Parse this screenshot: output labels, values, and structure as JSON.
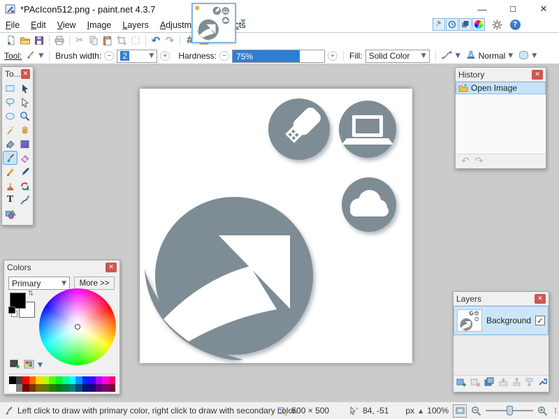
{
  "window": {
    "title": "*PAcIcon512.png - paint.net 4.3.7",
    "controls": {
      "minimize": "–",
      "maximize": "▢",
      "close": "✕"
    }
  },
  "menu": {
    "items": [
      {
        "label": "File",
        "underline_index": 0
      },
      {
        "label": "Edit",
        "underline_index": 0
      },
      {
        "label": "View",
        "underline_index": 0
      },
      {
        "label": "Image",
        "underline_index": 0
      },
      {
        "label": "Layers",
        "underline_index": 0
      },
      {
        "label": "Adjustments",
        "underline_index": 0
      },
      {
        "label": "Effects",
        "underline_index": 4
      }
    ]
  },
  "top_right_icons": [
    "tools-toggle-icon",
    "history-toggle-icon",
    "layers-toggle-icon",
    "colors-toggle-icon",
    "settings-gear-icon",
    "help-icon"
  ],
  "toolbar_icons": [
    "new-file-icon",
    "open-folder-icon",
    "save-icon",
    "print-icon",
    "cut-icon",
    "copy-icon",
    "paste-icon",
    "crop-icon",
    "deselect-icon",
    "undo-icon",
    "redo-icon",
    "grid-icon",
    "ruler-icon"
  ],
  "tool_options": {
    "tool_label": "Tool:",
    "brush_width_label": "Brush width:",
    "brush_width_value": "2",
    "hardness_label": "Hardness:",
    "hardness_value": "75%",
    "hardness_fill_percent": 73,
    "fill_label": "Fill:",
    "fill_value": "Solid Color",
    "blend_mode_value": "Normal"
  },
  "image_tab": {
    "icons": [
      "unsaved-star-icon",
      "thumbnail-pdn-logo"
    ],
    "chevron": "⌄"
  },
  "panels": {
    "tools": {
      "title": "To...",
      "selected_tool": "paintbrush",
      "icons": [
        "rectangle-select",
        "move-selected-pixels",
        "lasso-select",
        "move-selection",
        "ellipse-select",
        "zoom",
        "magic-wand",
        "pan",
        "paint-bucket",
        "gradient",
        "paintbrush",
        "eraser",
        "pencil",
        "color-picker",
        "clone-stamp",
        "recolor",
        "text",
        "line-curve",
        "shapes"
      ]
    },
    "history": {
      "title": "History",
      "items": [
        {
          "label": "Open Image",
          "selected": true
        }
      ],
      "footer_icons": {
        "undo": "↶",
        "redo": "↷"
      }
    },
    "colors": {
      "title": "Colors",
      "mode_value": "Primary",
      "more_button": "More >>",
      "primary_color": "#000000",
      "secondary_color": "#ffffff",
      "palette_row1": [
        "#000000",
        "#404040",
        "#FF0000",
        "#FF6A00",
        "#FFD800",
        "#B6FF00",
        "#4CFF00",
        "#00FF21",
        "#00FF90",
        "#00FFFF",
        "#0094FF",
        "#0026FF",
        "#4800FF",
        "#B200FF",
        "#FF00DC",
        "#FF006E"
      ],
      "palette_row2": [
        "#FFFFFF",
        "#808080",
        "#7F0000",
        "#7F3300",
        "#7F6A00",
        "#5B7F00",
        "#267F00",
        "#007F0E",
        "#007F46",
        "#007F7F",
        "#004A7F",
        "#00137F",
        "#21007F",
        "#57007F",
        "#7F006E",
        "#7F0037"
      ]
    },
    "layers": {
      "title": "Layers",
      "items": [
        {
          "label": "Background",
          "visible": true,
          "selected": true
        }
      ],
      "footer_icons": [
        "add-layer-icon",
        "delete-layer-icon",
        "duplicate-layer-icon",
        "merge-down-icon",
        "move-layer-up-icon",
        "move-layer-down-icon",
        "layer-properties-icon"
      ]
    }
  },
  "canvas": {
    "background": "#ffffff",
    "artwork_color": "#7e8c95",
    "artwork_icons": [
      "swirl-arrow-logo",
      "usb-drive-icon",
      "laptop-icon",
      "cloud-icon"
    ]
  },
  "statusbar": {
    "hint": "Left click to draw with primary color, right click to draw with secondary color.",
    "image_size": "500 × 500",
    "cursor_position": "84, -51",
    "unit": "px",
    "zoom_level": "100%"
  }
}
